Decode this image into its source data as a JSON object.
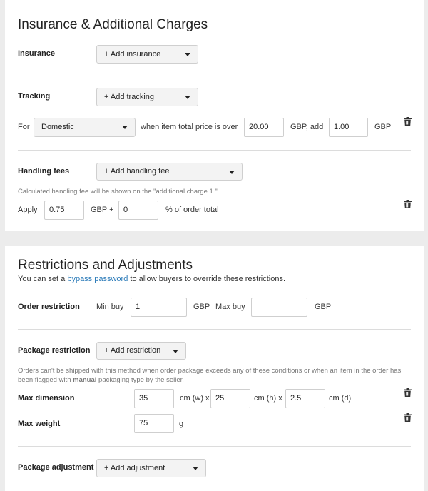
{
  "insurance_section": {
    "title": "Insurance & Additional Charges",
    "insurance": {
      "label": "Insurance",
      "button": "+ Add insurance"
    },
    "tracking": {
      "label": "Tracking",
      "button": "+ Add tracking",
      "for_label": "For",
      "region_value": "Domestic",
      "condition_text": "when item total price is over",
      "threshold_value": "20.00",
      "currency_add_text": "GBP, add",
      "add_value": "1.00",
      "currency_text": "GBP"
    },
    "handling": {
      "label": "Handling fees",
      "button": "+ Add handling fee",
      "note": "Calculated handling fee will be shown on the \"additional charge 1.\"",
      "apply_label": "Apply",
      "fixed_value": "0.75",
      "currency_plus_text": "GBP +",
      "percent_value": "0",
      "percent_text": "% of order total"
    }
  },
  "restrictions_section": {
    "title": "Restrictions and Adjustments",
    "subtitle_prefix": "You can set a",
    "subtitle_link": "bypass password",
    "subtitle_suffix": "to allow buyers to override these restrictions.",
    "order": {
      "label": "Order restriction",
      "min_label": "Min buy",
      "min_value": "1",
      "min_currency": "GBP",
      "max_label": "Max buy",
      "max_value": "",
      "max_currency": "GBP"
    },
    "package": {
      "label": "Package restriction",
      "button": "+ Add restriction",
      "note_part1": "Orders can't be shipped with this method when order package exceeds any of these conditions or when an item in the order has been flagged with",
      "note_bold": "manual",
      "note_part2": "packaging type by the seller.",
      "max_dimension_label": "Max dimension",
      "width_value": "35",
      "width_unit": "cm (w) x",
      "height_value": "25",
      "height_unit": "cm (h) x",
      "depth_value": "2.5",
      "depth_unit": "cm (d)",
      "max_weight_label": "Max weight",
      "weight_value": "75",
      "weight_unit": "g"
    },
    "adjustment": {
      "label": "Package adjustment",
      "button": "+ Add adjustment"
    }
  },
  "icons": {
    "delete": "trash-icon",
    "dropdown": "caret-down-icon"
  },
  "colors": {
    "background": "#ececec",
    "panel": "#ffffff",
    "link": "#2a7ab8",
    "divider": "#dcdcdc"
  }
}
